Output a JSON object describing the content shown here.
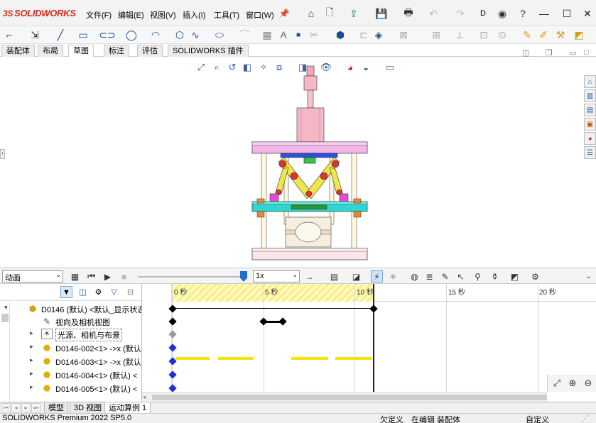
{
  "app": {
    "logo_text": "SOLIDWORKS",
    "logo_mark": "3S",
    "menu": [
      "文件(F)",
      "编辑(E)",
      "视图(V)",
      "插入(I)",
      "工具(T)",
      "窗口(W)"
    ],
    "title_short": "D"
  },
  "tabs": [
    "装配体",
    "布局",
    "草图",
    "标注",
    "评估",
    "SOLIDWORKS 插件"
  ],
  "active_tab": "草图",
  "motion": {
    "study_type": "动画",
    "playback_speed": "1x",
    "ruler_labels": [
      "0 秒",
      "5 秒",
      "10 秒",
      "15 秒",
      "20 秒"
    ]
  },
  "tree": {
    "items": [
      {
        "label": "D0146 (默认) <默认_显示状态",
        "expander": "▾",
        "icon": "assembly-icon"
      },
      {
        "label": "视向及相机视图",
        "expander": "",
        "icon": "camera-icon"
      },
      {
        "label": "光源、相机与布景",
        "expander": "▸",
        "icon": "lights-icon"
      },
      {
        "label": "D0146-002<1> ->x (默认",
        "expander": "▸",
        "icon": "part-icon"
      },
      {
        "label": "D0146-003<1> ->x (默认",
        "expander": "▸",
        "icon": "part-icon"
      },
      {
        "label": "D0146-004<1> (默认) <",
        "expander": "▸",
        "icon": "part-icon"
      },
      {
        "label": "D0146-005<1> (默认) <",
        "expander": "▸",
        "icon": "part-icon"
      }
    ]
  },
  "bottom_tabs": [
    "模型",
    "3D 视图",
    "运动算例 1"
  ],
  "active_bottom_tab": "运动算例 1",
  "status": {
    "product": "SOLIDWORKS Premium 2022 SP5.0",
    "constraint": "欠定义",
    "editing": "在编辑 装配体",
    "units": "自定义"
  },
  "colors": {
    "keyframe_black": "#000000",
    "keyframe_blue": "#1d2fd6",
    "keyframe_gray": "#9a9a9a",
    "timebar_yellow": "#f3e600",
    "timeline_hatch": "#f9f08a",
    "accent_blue": "#1f6fd1",
    "brand_red": "#d52b1e"
  }
}
